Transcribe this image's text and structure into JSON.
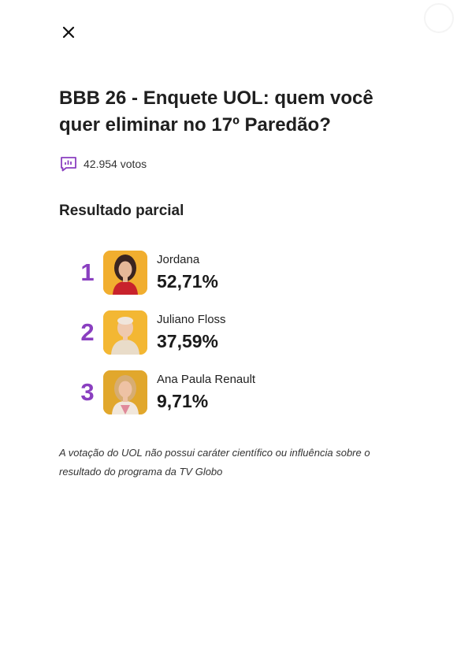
{
  "poll": {
    "title": "BBB 26 - Enquete UOL: quem você quer eliminar no 17º Paredão?",
    "votes_label": "42.954 votos",
    "section_title": "Resultado parcial",
    "results": [
      {
        "rank": "1",
        "name": "Jordana",
        "percent": "52,71%"
      },
      {
        "rank": "2",
        "name": "Juliano Floss",
        "percent": "37,59%"
      },
      {
        "rank": "3",
        "name": "Ana Paula Renault",
        "percent": "9,71%"
      }
    ],
    "disclaimer": "A votação do UOL não possui caráter científico ou influência sobre o resultado do programa da TV Globo"
  },
  "icons": {
    "close": "close-icon",
    "votes": "bar-chart-icon"
  },
  "colors": {
    "accent": "#8a3fc0",
    "avatar_background": "#f2b430"
  }
}
